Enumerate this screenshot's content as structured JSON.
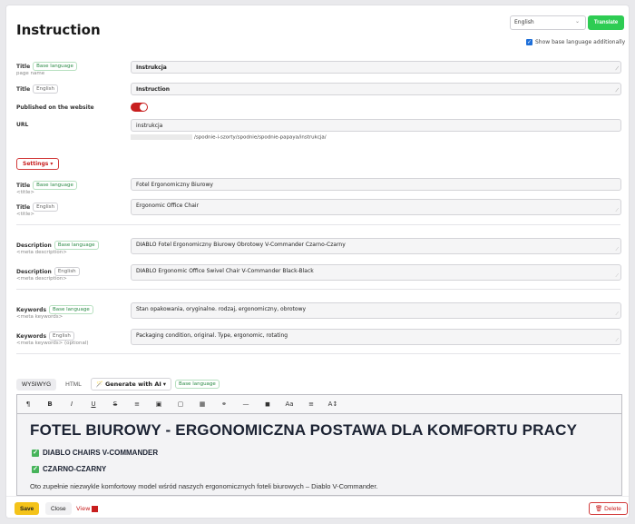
{
  "header": {
    "title": "Instruction",
    "language_select": {
      "value": "English"
    },
    "translate_label": "Translate",
    "show_base_label": "Show base language additionally"
  },
  "fields": {
    "page_name": {
      "label": "Title",
      "tag": "Base language",
      "sub": "page name",
      "value": "Instrukcja"
    },
    "title_en": {
      "label": "Title",
      "tag": "English",
      "value": "Instruction"
    },
    "published": {
      "label": "Published on the website",
      "on": true
    },
    "url": {
      "label": "URL",
      "value": "instrukcja",
      "path": "/spodnie-i-szorty/spodnie/spodnie-papaya/instrukcja/"
    }
  },
  "settings_label": "Settings",
  "seo": {
    "title_base": {
      "label": "Title",
      "tag": "Base language",
      "sub": "<title>",
      "value": "Fotel Ergonomiczny Biurowy"
    },
    "title_en": {
      "label": "Title",
      "tag": "English",
      "sub": "<title>",
      "value": "Ergonomic Office Chair"
    },
    "desc_base": {
      "label": "Description",
      "tag": "Base language",
      "sub": "<meta description>",
      "value": "DIABLO Fotel Ergonomiczny Biurowy Obrotowy V-Commander Czarno-Czarny"
    },
    "desc_en": {
      "label": "Description",
      "tag": "English",
      "sub": "<meta description>",
      "value": "DIABLO Ergonomic Office Swivel Chair V-Commander Black-Black"
    },
    "kw_base": {
      "label": "Keywords",
      "tag": "Base language",
      "sub": "<meta keywords>",
      "value": "Stan opakowania, oryginalne. rodzaj, ergonomiczny, obrotowy"
    },
    "kw_en": {
      "label": "Keywords",
      "tag": "English",
      "sub": "<meta keywords> (optional)",
      "value": "Packaging condition, original. Type, ergonomic, rotating"
    }
  },
  "editor": {
    "tab_wysiwyg": "WYSIWYG",
    "tab_html": "HTML",
    "ai_label": "Generate with AI",
    "tag": "Base language",
    "heading": "FOTEL BIUROWY - ERGONOMICZNA POSTAWA DLA KOMFORTU PRACY",
    "items": [
      "DIABLO CHAIRS V-COMMANDER",
      "CZARNO-CZARNY"
    ],
    "paragraph": "Oto zupełnie niezwykle komfortowy model wśród naszych ergonomicznych foteli biurowych – Diablo V-Commander."
  },
  "toolbar": {
    "paragraph": "¶",
    "bold": "B",
    "italic": "I",
    "underline": "U",
    "strike": "S",
    "list": "≡",
    "image": "▣",
    "video": "▢",
    "table": "▦",
    "link": "⚭",
    "hr": "—",
    "code": "◼",
    "font_size": "Aa",
    "align": "≡",
    "text_height": "A↕"
  },
  "footer": {
    "save": "Save",
    "close": "Close",
    "view": "View",
    "delete": "Delete"
  }
}
